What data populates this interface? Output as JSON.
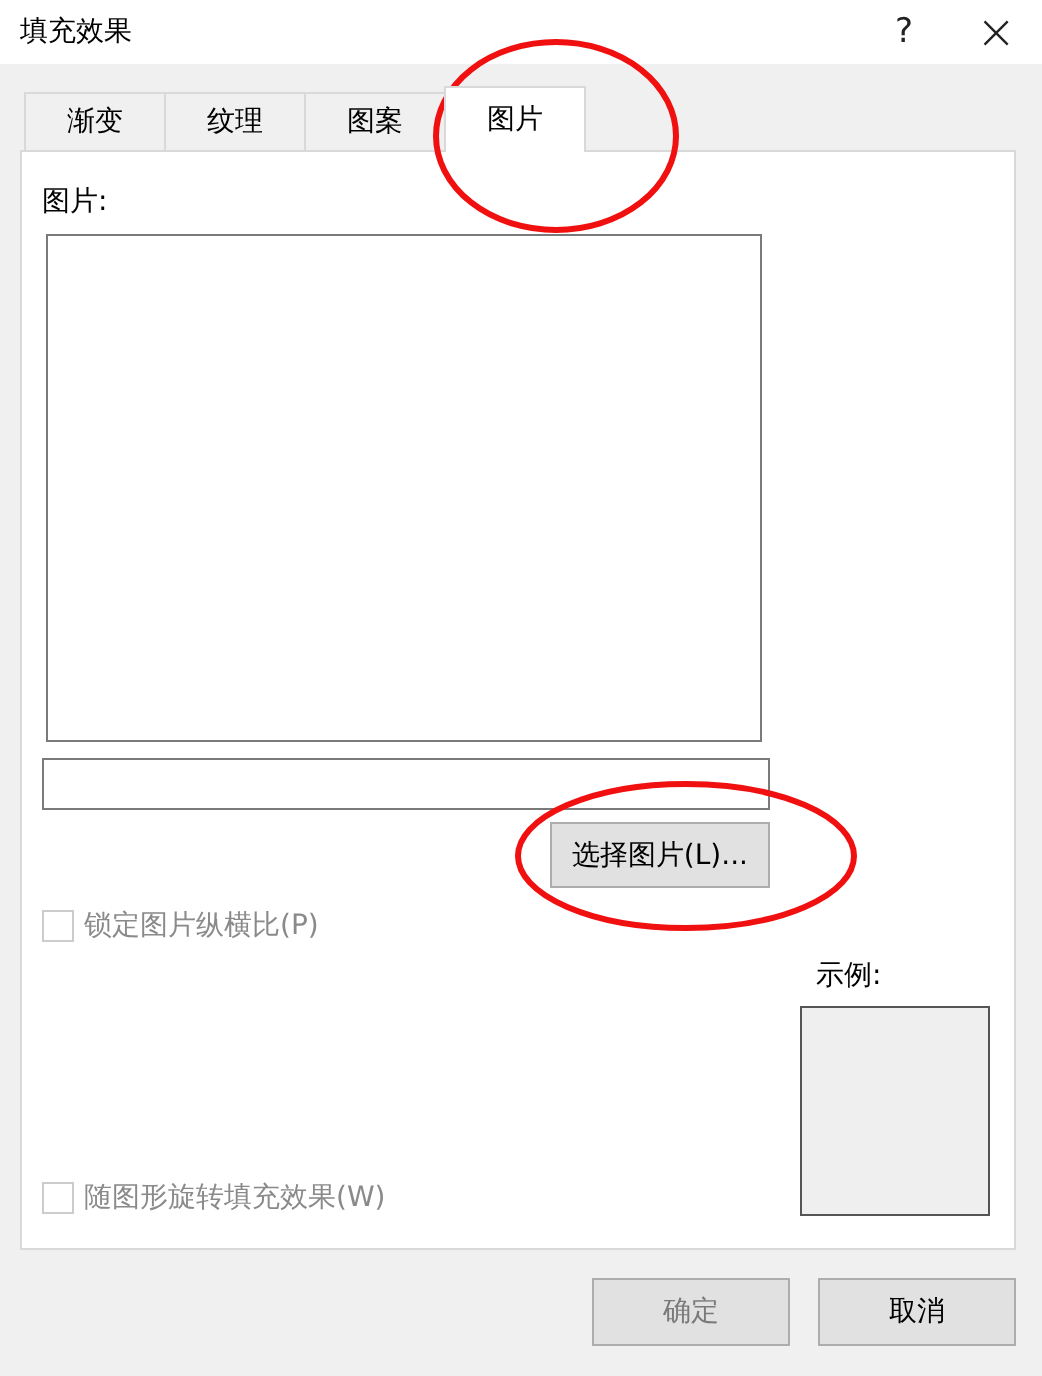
{
  "window": {
    "title": "填充效果",
    "help": "?",
    "close": "×"
  },
  "tabs": [
    {
      "label": "渐变",
      "selected": false,
      "circled": false
    },
    {
      "label": "纹理",
      "selected": false,
      "circled": false
    },
    {
      "label": "图案",
      "selected": false,
      "circled": false
    },
    {
      "label": "图片",
      "selected": true,
      "circled": true
    }
  ],
  "picture_label": "图片:",
  "select_button": {
    "label": "选择图片(L)...",
    "circled": true
  },
  "options": [
    {
      "label": "锁定图片纵横比(P)",
      "checked": false,
      "disabled": true
    },
    {
      "label": "随图形旋转填充效果(W)",
      "checked": false,
      "disabled": true
    }
  ],
  "sample_label": "示例:",
  "buttons": [
    {
      "label": "确定",
      "disabled": true
    },
    {
      "label": "取消",
      "disabled": false
    }
  ]
}
